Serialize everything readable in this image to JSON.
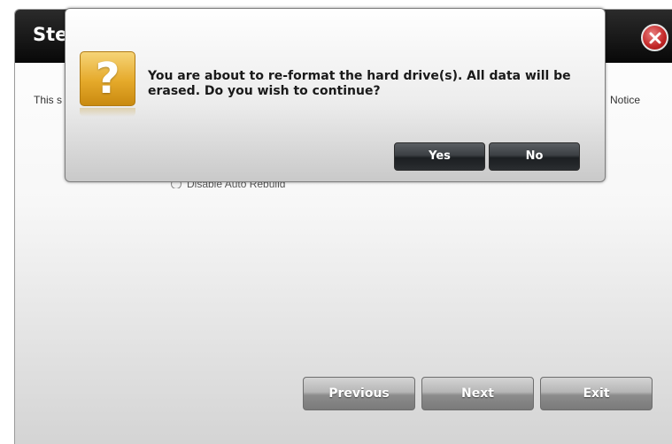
{
  "wizard": {
    "title": "Ste",
    "description_left": "This s that t",
    "description_right": "Notice",
    "rebuild_option_label": "Disable Auto Rebuild",
    "buttons": {
      "previous": "Previous",
      "next": "Next",
      "exit": "Exit"
    },
    "close_icon": "close-icon"
  },
  "dialog": {
    "icon": "question-icon",
    "icon_glyph": "?",
    "message": "You are about to re-format the hard drive(s). All data will be erased. Do you wish to continue?",
    "yes_label": "Yes",
    "no_label": "No"
  },
  "colors": {
    "header_bg": "#111111",
    "close_red": "#c22525",
    "icon_gold": "#e5a92a",
    "dialog_button": "#2a2d30"
  }
}
